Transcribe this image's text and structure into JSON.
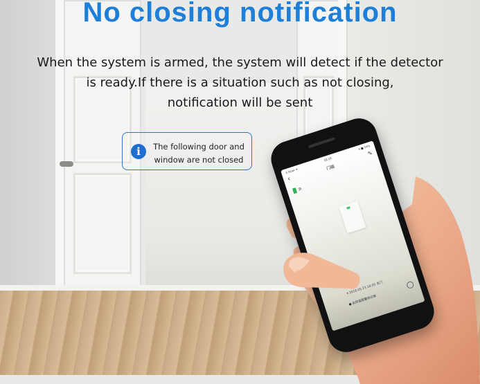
{
  "title": "No closing notification",
  "description_lines": [
    "When the system is armed, the system will detect if the detector",
    "is ready.If there is a situation such as not closing,",
    "notification will be sent"
  ],
  "callout": {
    "icon": "info-icon",
    "lines": [
      "The following door and",
      "window are not closed"
    ]
  },
  "colors": {
    "title": "#1e7fd8",
    "callout_border": "#2a74c9",
    "info_icon": "#1f6fd1",
    "status_green": "#2fb15a"
  },
  "phone_screen": {
    "status_left": "X Doer ✦",
    "time": "18:18",
    "status_right": "▾ ■ 54%",
    "title": "门磁",
    "device_label": "开",
    "timestamp": "▾ 2018.05.23 18:05 关门",
    "record_label": "此防盗报警存记录"
  }
}
